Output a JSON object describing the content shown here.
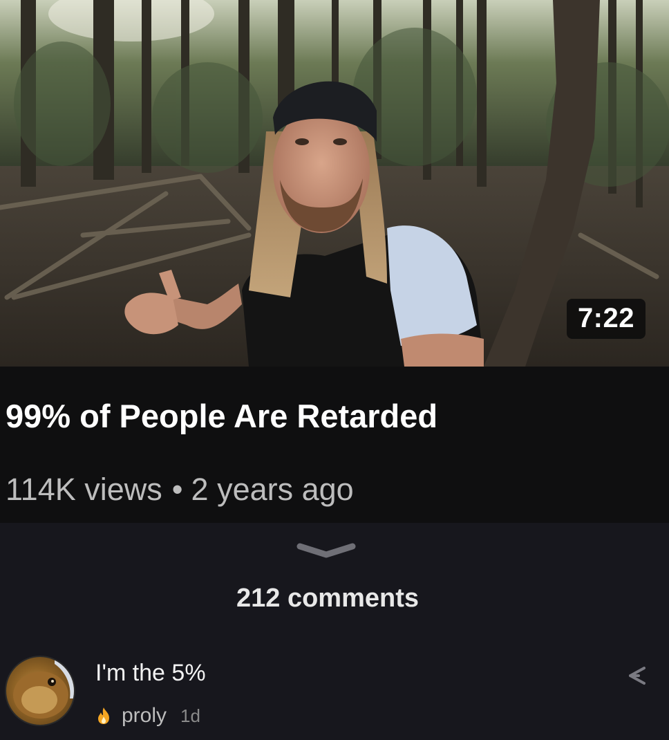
{
  "video": {
    "duration": "7:22",
    "title": "99% of People Are Retarded",
    "views": "114K views",
    "separator": "•",
    "age": "2 years ago"
  },
  "comments_section": {
    "count_label": "212 comments",
    "comment": {
      "text": "I'm the 5%",
      "author": "proly",
      "time": "1d"
    }
  },
  "colors": {
    "background": "#0f0f10",
    "comments_background": "#17171d",
    "meta_text": "#bdbdbd",
    "accent_fire": "#f5a623"
  },
  "icons": [
    "chevron-down-icon",
    "fire-icon",
    "reply-icon"
  ]
}
